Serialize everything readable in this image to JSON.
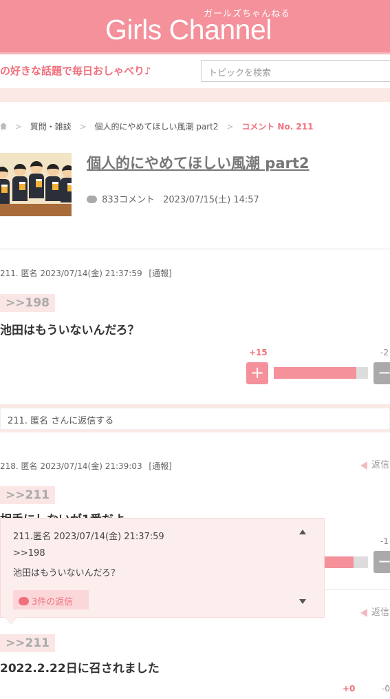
{
  "header": {
    "logo_small": "ガールズちゃんねる",
    "logo": "Girls Channel",
    "tagline": "の好きな話題で毎日おしゃべり♪",
    "search_placeholder": "トピックを検索"
  },
  "breadcrumb": {
    "items": [
      "質問・雑談",
      "個人的にやめてほしい風潮 part2"
    ],
    "current": "コメント No. 211"
  },
  "topic": {
    "title": "個人的にやめてほしい風潮 part2",
    "comment_count": "833コメント",
    "date": "2023/07/15(土) 14:57"
  },
  "comments": [
    {
      "header": "211. 匿名 2023/07/14(金) 21:37:59",
      "report": "[通報]",
      "anchor": ">>198",
      "text": "池田はもういないんだろ？",
      "plus": "+15",
      "minus": "-2",
      "plus_ratio": 0.88
    },
    {
      "header": "218. 匿名 2023/07/14(金) 21:39:03",
      "report": "[通報]",
      "reply_label": "返信",
      "anchor": ">>211",
      "text": "相手にしないが1番だよ",
      "minus": "-1",
      "plus_ratio": 0.85
    },
    {
      "reply_label": "返信",
      "anchor": ">>211",
      "text": "2022.2.22日に召されました",
      "plus": "+0",
      "minus": "-0"
    }
  ],
  "reply_prompt": "211. 匿名 さんに返信する",
  "popup": {
    "header": "211.匿名 2023/07/14(金) 21:37:59",
    "anchor": ">>198",
    "text": "池田はもういないんだろ？",
    "replies": "3件の返信"
  },
  "icons": {
    "home": "home-icon",
    "comment": "speech-bubble-icon",
    "reply": "reply-arrow-icon",
    "plus": "plus-icon",
    "minus": "minus-icon"
  },
  "colors": {
    "brand": "#f4919b",
    "accent": "#f0707d",
    "band": "#fbe9e6"
  }
}
